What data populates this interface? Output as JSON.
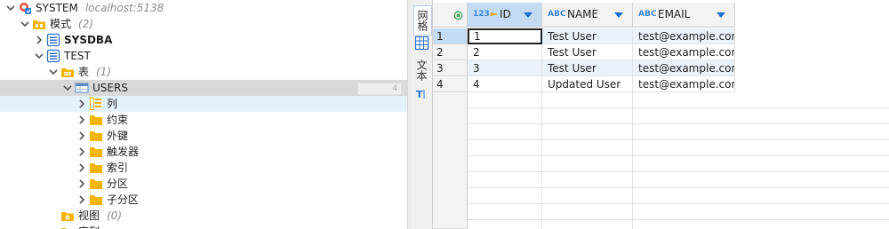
{
  "tree": {
    "connection": {
      "label": "SYSTEM",
      "host": "localhost:5138"
    },
    "schemas": {
      "label": "模式",
      "count": "(2)"
    },
    "sysdba": {
      "label": "SYSDBA"
    },
    "test": {
      "label": "TEST"
    },
    "tables": {
      "label": "表",
      "count": "(1)"
    },
    "users": {
      "label": "USERS",
      "size_value": "4"
    },
    "children": [
      {
        "label": "列"
      },
      {
        "label": "约束"
      },
      {
        "label": "外键"
      },
      {
        "label": "触发器"
      },
      {
        "label": "索引"
      },
      {
        "label": "分区"
      },
      {
        "label": "子分区"
      }
    ],
    "views": {
      "label": "视图",
      "count": "(0)"
    },
    "cut_off_label": "序列"
  },
  "side_tabs": {
    "grid": "网格",
    "text": "文本"
  },
  "grid": {
    "columns": [
      {
        "type": "123",
        "name": "ID"
      },
      {
        "type": "ABC",
        "name": "NAME"
      },
      {
        "type": "ABC",
        "name": "EMAIL"
      }
    ],
    "rows": [
      {
        "num": "1",
        "id": "1",
        "name": "Test User",
        "email": "test@example.com"
      },
      {
        "num": "2",
        "id": "2",
        "name": "Test User",
        "email": "test@example.com"
      },
      {
        "num": "3",
        "id": "3",
        "name": "Test User",
        "email": "test@example.com"
      },
      {
        "num": "4",
        "id": "4",
        "name": "Updated User",
        "email": "test@example.com"
      }
    ]
  },
  "colors": {
    "folder": "#f4b400",
    "selection": "#d9d9d9",
    "header_active": "#c4dcf3",
    "accent": "#1e6cc9"
  }
}
